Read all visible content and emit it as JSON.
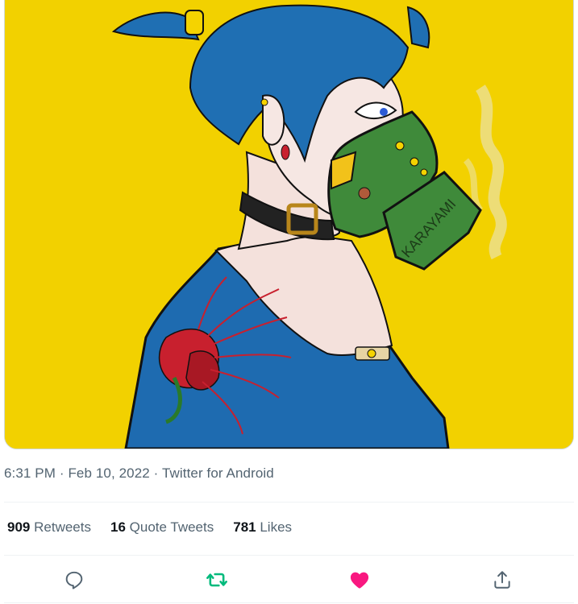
{
  "media": {
    "alt": "Illustration of a blue-haired woman wearing a green gas mask and choker on a yellow background",
    "mask_text": "KARAYAMI",
    "colors": {
      "background": "#f2d100",
      "hair": "#1f6fb3",
      "mask": "#3f8a3a",
      "shirt": "#1e6bb0",
      "flower": "#c8202e"
    }
  },
  "meta": {
    "time": "6:31 PM",
    "date": "Feb 10, 2022",
    "source": "Twitter for Android",
    "sep": "·"
  },
  "stats": {
    "retweets_count": "909",
    "retweets_label": "Retweets",
    "quotes_count": "16",
    "quotes_label": "Quote Tweets",
    "likes_count": "781",
    "likes_label": "Likes"
  },
  "actions": [
    {
      "name": "reply",
      "icon": "reply-icon",
      "color": "#536471"
    },
    {
      "name": "retweet",
      "icon": "retweet-icon",
      "color": "#00ba7c",
      "active": true
    },
    {
      "name": "like",
      "icon": "heart-icon",
      "color": "#f91880",
      "active": true
    },
    {
      "name": "share",
      "icon": "share-icon",
      "color": "#536471"
    }
  ]
}
